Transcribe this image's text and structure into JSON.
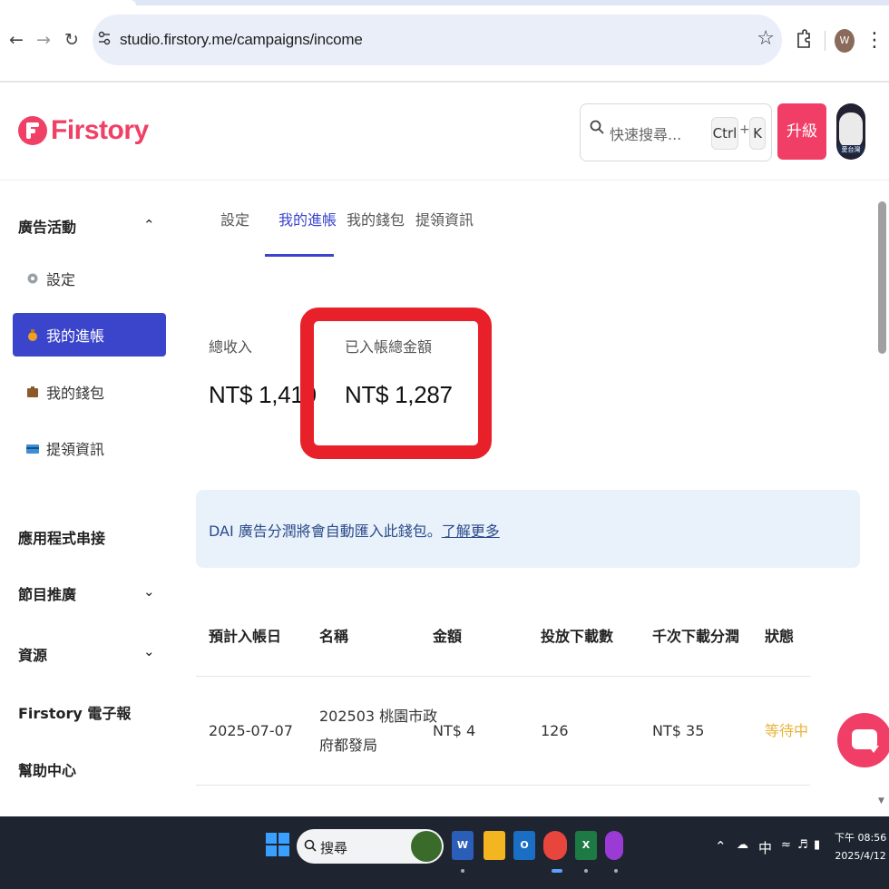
{
  "browser": {
    "url": "studio.firstory.me/campaigns/income",
    "profile_initial": "W"
  },
  "header": {
    "brand": "Firstory",
    "search_placeholder": "快速搜尋...",
    "kbd_ctrl": "Ctrl",
    "kbd_plus": "+",
    "kbd_key": "K",
    "upgrade_label": "升級",
    "avatar_caption": "愛台灣"
  },
  "sidebar": {
    "ad_section": "廣告活動",
    "ad_items": [
      {
        "label": "設定",
        "icon": "gear-icon"
      },
      {
        "label": "我的進帳",
        "icon": "money-bag-icon"
      },
      {
        "label": "我的錢包",
        "icon": "wallet-icon"
      },
      {
        "label": "提領資訊",
        "icon": "card-icon"
      }
    ],
    "sections": [
      "應用程式串接",
      "節目推廣",
      "資源",
      "Firstory 電子報",
      "幫助中心"
    ]
  },
  "tabs": [
    "設定",
    "我的進帳",
    "我的錢包",
    "提領資訊"
  ],
  "stats": {
    "total_income_label": "總收入",
    "total_income_value": "NT$ 1,410",
    "credited_label": "已入帳總金額",
    "credited_value": "NT$ 1,287"
  },
  "banner": {
    "text": "DAI 廣告分潤將會自動匯入此錢包。",
    "link": "了解更多"
  },
  "table": {
    "headers": [
      "預計入帳日",
      "名稱",
      "金額",
      "投放下載數",
      "千次下載分潤",
      "狀態"
    ],
    "rows": [
      {
        "date": "2025-07-07",
        "name_line1": "202503 桃園市政",
        "name_line2": "府都發局",
        "amount": "NT$ 4",
        "downloads": "126",
        "cpm": "NT$ 35",
        "status": "等待中"
      }
    ]
  },
  "taskbar": {
    "search_label": "搜尋",
    "ime": "中",
    "time": "下午 08:56",
    "date": "2025/4/12"
  },
  "colors": {
    "brand": "#f04066",
    "accent": "#3b45cc",
    "highlight": "#e8202a",
    "pending": "#e8b33a"
  }
}
